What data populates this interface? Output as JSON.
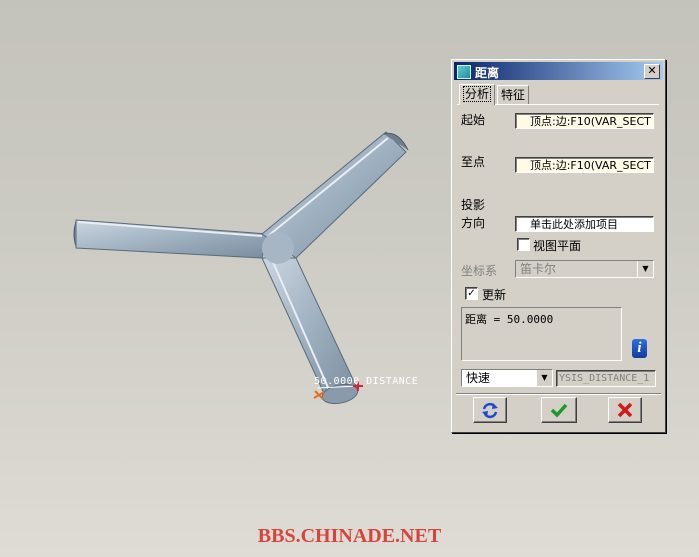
{
  "dialog": {
    "title": "距离",
    "close_glyph": "✕",
    "tabs": [
      "分析",
      "特征"
    ],
    "from_label": "起始",
    "from_value": "顶点:边:F10(VAR_SECT",
    "to_label": "至点",
    "to_value": "顶点:边:F10(VAR_SECT",
    "projection_label": "投影",
    "direction_label": "方向",
    "direction_value": "单击此处添加项目",
    "view_plane_label": "视图平面",
    "view_plane_checked": false,
    "coord_label": "坐标系",
    "coord_value": "笛卡尔",
    "update_label": "更新",
    "update_checked": true,
    "result_text": "距离  = 50.0000",
    "mode_value": "快速",
    "feature_name": "YSIS_DISTANCE_1",
    "buttons": {
      "repeat_icon": "refresh-arrows-icon",
      "ok_icon": "green-check-icon",
      "cancel_icon": "red-x-icon"
    }
  },
  "viewport": {
    "dimension_label": "50.0000  DISTANCE"
  },
  "watermark": "BBS.CHINADE.NET",
  "colors": {
    "title_bar_start": "#0a246a",
    "title_bar_end": "#a6caf0",
    "dialog_bg": "#d4d0c8",
    "model_color": "#a7b6c4",
    "watermark": "#d6453c"
  }
}
